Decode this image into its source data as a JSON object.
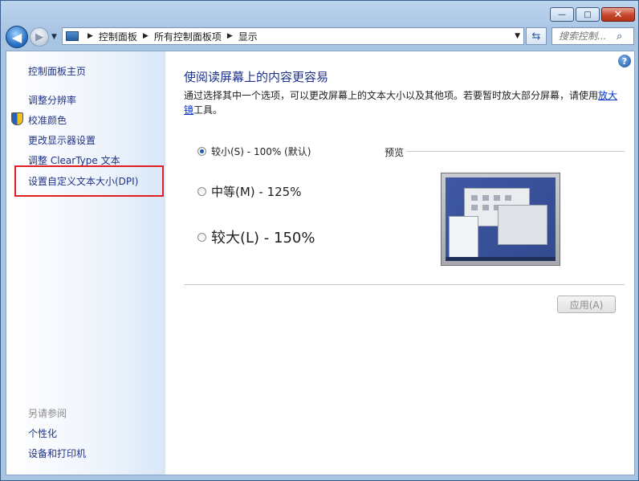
{
  "window": {
    "caption_buttons": {
      "minimize": "—",
      "maximize": "□",
      "close": "✕"
    }
  },
  "nav": {
    "address": [
      "控制面板",
      "所有控制面板项",
      "显示"
    ],
    "search_placeholder": "搜索控制..."
  },
  "sidebar": {
    "home": "控制面板主页",
    "links": [
      "调整分辨率",
      "校准颜色",
      "更改显示器设置",
      "调整 ClearType 文本",
      "设置自定义文本大小(DPI)"
    ],
    "see_also_title": "另请参阅",
    "see_also": [
      "个性化",
      "设备和打印机"
    ]
  },
  "main": {
    "heading": "使阅读屏幕上的内容更容易",
    "desc_before": "通过选择其中一个选项，可以更改屏幕上的文本大小以及其他项。若要暂时放大部分屏幕，请使用",
    "desc_link": "放大镜",
    "desc_after": "工具。",
    "options": [
      {
        "label": "较小(S) - 100% (默认)",
        "selected": true
      },
      {
        "label": "中等(M) - 125%",
        "selected": false
      },
      {
        "label": "较大(L) - 150%",
        "selected": false
      }
    ],
    "preview_label": "预览",
    "apply_label": "应用(A)"
  },
  "colors": {
    "link": "#1e3287",
    "highlight_box": "#e02020"
  }
}
